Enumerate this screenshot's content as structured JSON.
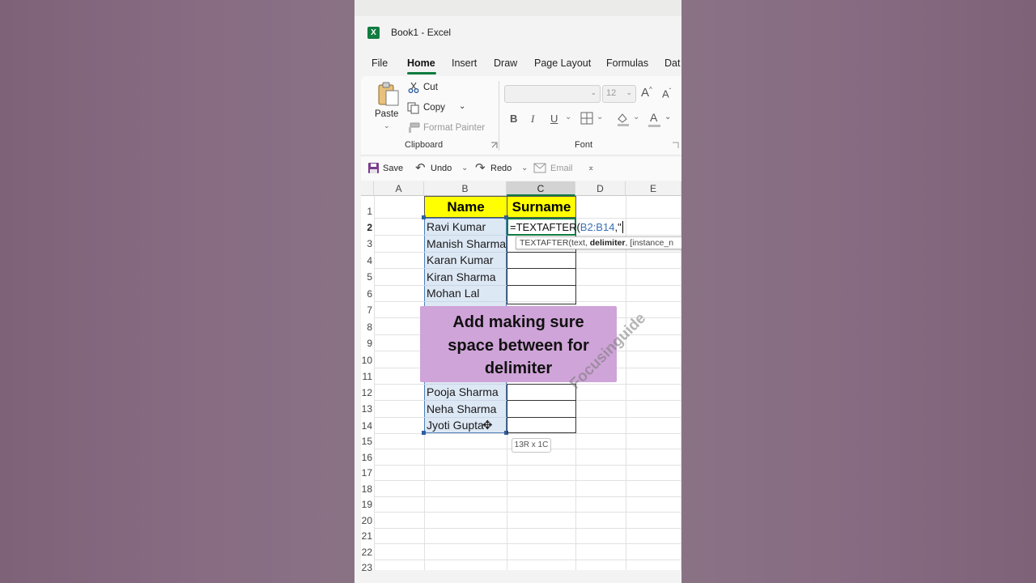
{
  "app": {
    "logo_letter": "X",
    "title": "Book1  -  Excel"
  },
  "menu_tabs": [
    "File",
    "Home",
    "Insert",
    "Draw",
    "Page Layout",
    "Formulas",
    "Dat"
  ],
  "ribbon": {
    "clipboard": {
      "paste_label": "Paste",
      "cut_label": "Cut",
      "copy_label": "Copy",
      "format_painter_label": "Format Painter",
      "group_label": "Clipboard"
    },
    "font": {
      "font_name_value": "",
      "font_size_value": "12",
      "bold": "B",
      "italic": "I",
      "underline": "U",
      "group_label": "Font"
    }
  },
  "quick_access": {
    "save_label": "Save",
    "undo_label": "Undo",
    "redo_label": "Redo",
    "email_label": "Email"
  },
  "sheet": {
    "columns": [
      "A",
      "B",
      "C",
      "D",
      "E"
    ],
    "selected_column": "C",
    "rows": [
      "1",
      "2",
      "3",
      "4",
      "5",
      "6",
      "7",
      "8",
      "9",
      "10",
      "11",
      "12",
      "13",
      "14",
      "15",
      "16",
      "17",
      "18",
      "19",
      "20",
      "21",
      "22",
      "23"
    ],
    "header_name": "Name",
    "header_surname": "Surname",
    "names": [
      "Ravi Kumar",
      "Manish Sharma",
      "Karan Kumar",
      "Kiran Sharma",
      "Mohan Lal",
      "",
      "",
      "",
      "",
      "Pooja Sharma",
      "Neha Sharma",
      "Jyoti Gupta"
    ],
    "formula_prefix": "=TEXTAFTER(",
    "formula_range": "B2:B14",
    "formula_suffix": ",\"",
    "tooltip_fn": "TEXTAFTER(text, ",
    "tooltip_bold": "delimiter",
    "tooltip_rest": ", [instance_n",
    "selection_size": "13R x 1C"
  },
  "colors": {
    "header_fill": "#ffff00",
    "overlay_fill": "#cfa4d8",
    "accent": "#107c41",
    "range_highlight": "#dde8f5"
  },
  "overlay_caption": [
    "Add making sure",
    "space between for",
    "delimiter"
  ],
  "watermark": "Focusinguide"
}
